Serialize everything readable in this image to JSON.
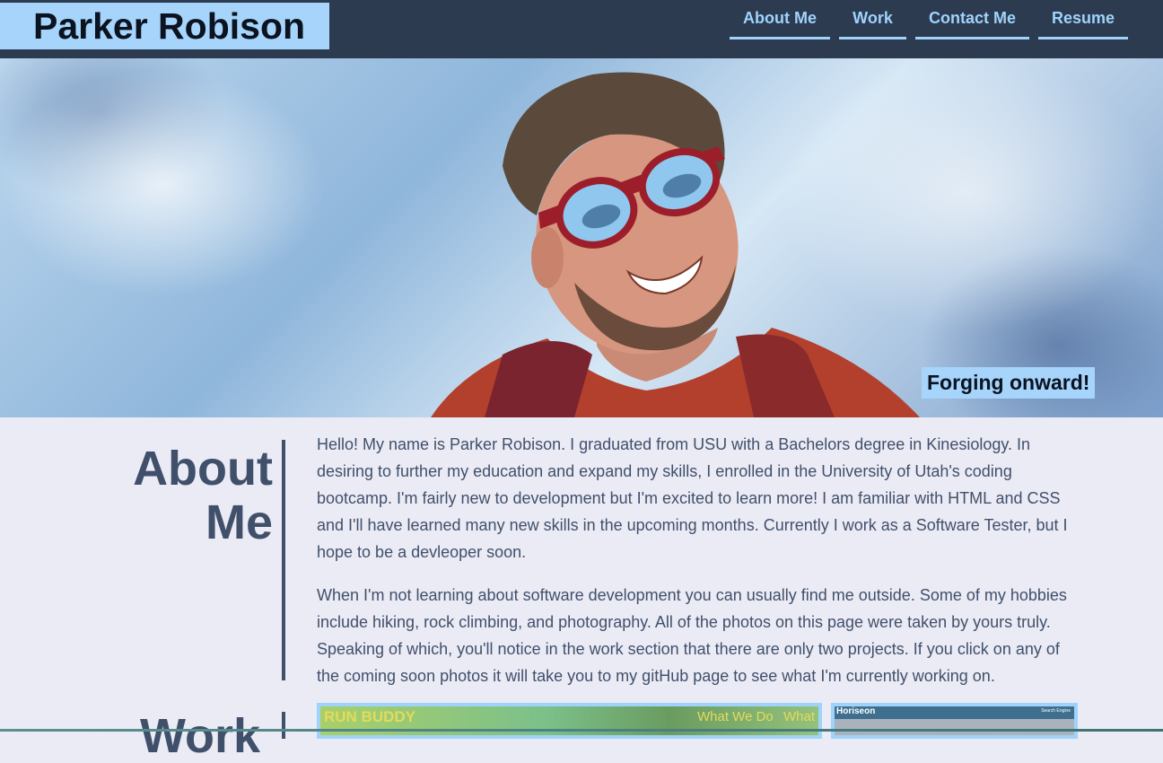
{
  "header": {
    "name": "Parker Robison",
    "nav": [
      {
        "label": "About Me"
      },
      {
        "label": "Work"
      },
      {
        "label": "Contact Me"
      },
      {
        "label": "Resume"
      }
    ]
  },
  "hero": {
    "caption": "Forging onward!"
  },
  "about": {
    "title_line1": "About",
    "title_line2": "Me",
    "paragraphs": [
      "Hello! My name is Parker Robison. I graduated from USU with a Bachelors degree in Kinesiology. In desiring to further my education and expand my skills, I enrolled in the University of Utah's coding bootcamp. I'm fairly new to development but I'm excited to learn more! I am familiar with HTML and CSS and I'll have learned many new skills in the upcoming months. Currently I work as a Software Tester, but I hope to be a devleoper soon.",
      "When I'm not learning about software development you can usually find me outside. Some of my hobbies include hiking, rock climbing, and photography. All of the photos on this page were taken by yours truly. Speaking of which, you'll notice in the work section that there are only two projects. If you click on any of the coming soon photos it will take you to my gitHub page to see what I'm currently working on."
    ]
  },
  "work": {
    "title": "Work",
    "projects": [
      {
        "title": "RUN BUDDY",
        "nav1": "What We Do",
        "nav2": "What"
      },
      {
        "title": "Horiseon",
        "nav1": "Search Engine"
      }
    ]
  },
  "colors": {
    "header_bg": "#2c3b50",
    "accent": "#a6d4fb",
    "page_bg": "#ebebf5",
    "text": "#40506b"
  }
}
